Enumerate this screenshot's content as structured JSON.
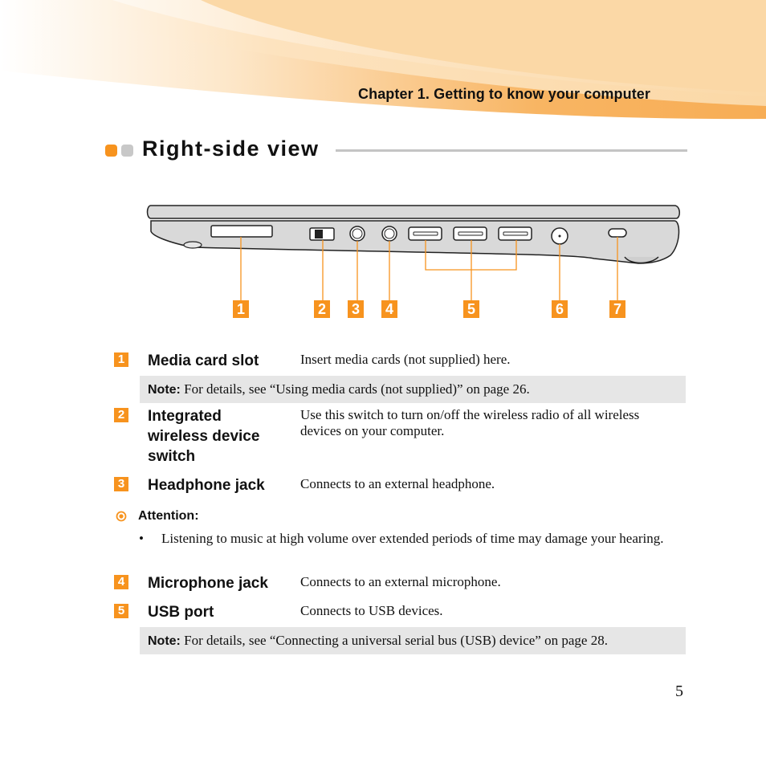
{
  "header": {
    "chapter_title": "Chapter 1. Getting to know your computer",
    "banner_color": "#f7b25a"
  },
  "section": {
    "title": "Right-side view",
    "accent_color": "#f7931e"
  },
  "diagram": {
    "image_description": "Right side view of laptop showing ports",
    "callouts": [
      "1",
      "2",
      "3",
      "4",
      "5",
      "6",
      "7"
    ]
  },
  "items": [
    {
      "number": "1",
      "term": "Media card slot",
      "description": "Insert media cards (not supplied) here."
    },
    {
      "number": "2",
      "term": "Integrated wireless device switch",
      "description": "Use this switch to turn on/off the wireless radio of all wireless devices on your computer."
    },
    {
      "number": "3",
      "term": "Headphone jack",
      "description": "Connects to an external headphone."
    },
    {
      "number": "4",
      "term": "Microphone jack",
      "description": "Connects to an external microphone."
    },
    {
      "number": "5",
      "term": "USB port",
      "description": "Connects to USB devices."
    }
  ],
  "notes": [
    {
      "label": "Note:",
      "text": "For details, see “Using media cards (not supplied)” on page 26."
    },
    {
      "label": "Note:",
      "text": "For details, see “Connecting a universal serial bus (USB) device” on page 28."
    }
  ],
  "attention": {
    "label": "Attention:",
    "bullet": "•",
    "text": "Listening to music at high volume over extended periods of time may damage your hearing."
  },
  "footer": {
    "page_number": "5"
  }
}
